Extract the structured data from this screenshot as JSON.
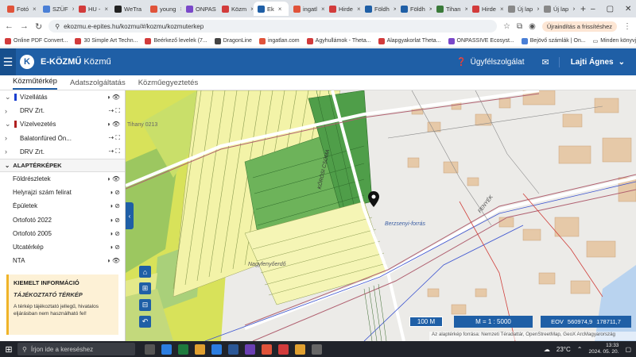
{
  "browser": {
    "tabs": [
      {
        "label": "Fotó",
        "color": "#e0533a"
      },
      {
        "label": "SZÜF",
        "color": "#4a7fd6"
      },
      {
        "label": "HU -",
        "color": "#d23b3b"
      },
      {
        "label": "WeTra",
        "color": "#222222"
      },
      {
        "label": "young",
        "color": "#e0533a"
      },
      {
        "label": "ONPAS",
        "color": "#7a48c9"
      },
      {
        "label": "Közm",
        "color": "#d23b3b"
      },
      {
        "label": "Ek",
        "color": "#1f5fa6",
        "active": true
      },
      {
        "label": "ingatl",
        "color": "#e0533a"
      },
      {
        "label": "Hirde",
        "color": "#d23b3b"
      },
      {
        "label": "Földh",
        "color": "#1f5fa6"
      },
      {
        "label": "Földh",
        "color": "#1f5fa6"
      },
      {
        "label": "Tihan",
        "color": "#3a7a3a"
      },
      {
        "label": "Hirde",
        "color": "#d23b3b"
      },
      {
        "label": "Új lap",
        "color": "#888888"
      },
      {
        "label": "Új lap",
        "color": "#888888"
      }
    ],
    "url": "ekozmu.e-epites.hu/kozmu/#/kozmu/kozmuterkep",
    "update_label": "Újraindítás a frissítéshez",
    "bookmarks": [
      {
        "label": "Online PDF Convert...",
        "color": "#d23b3b"
      },
      {
        "label": "30 Simple Art Techn...",
        "color": "#d23b3b"
      },
      {
        "label": "Beérkező levelek (7...",
        "color": "#d23b3b"
      },
      {
        "label": "DragonLine",
        "color": "#444444"
      },
      {
        "label": "ingatlan.com",
        "color": "#e0533a"
      },
      {
        "label": "Agyhullámok - Theta...",
        "color": "#d23b3b"
      },
      {
        "label": "Alapgyakorlat Theta...",
        "color": "#d23b3b"
      },
      {
        "label": "ONPASSIVE Ecosyst...",
        "color": "#7a48c9"
      },
      {
        "label": "Bejövő számlák | On...",
        "color": "#4a7fd6"
      }
    ],
    "bookmarks_right": "Minden könyvjelző"
  },
  "header": {
    "brand_bold": "E-KÖZMŰ",
    "brand_rest": "Közmű",
    "logo_letter": "K",
    "help_label": "Ügyfélszolgálat",
    "user_name": "Lajti Ágnes"
  },
  "subnav": [
    "Közműtérkép",
    "Adatszolgáltatás",
    "Közműegyeztetés"
  ],
  "sidebar": {
    "layers": [
      {
        "label": "Vízellátás",
        "chev": "⌄",
        "swatch": "#1a3fcf",
        "tools": "◑ 👁"
      },
      {
        "label": "DRV Zrt.",
        "chev": "›",
        "swatch": "",
        "tools": "⇢ ⛶"
      },
      {
        "label": "Vízelvezetés",
        "chev": "⌄",
        "swatch": "#b02020",
        "tools": "◑ 👁"
      },
      {
        "label": "Balatonfüred Ön...",
        "chev": "›",
        "swatch": "",
        "tools": "⇢ ⛶"
      },
      {
        "label": "DRV Zrt.",
        "chev": "›",
        "swatch": "",
        "tools": "⇢ ⛶"
      }
    ],
    "section_title": "ALAPTÉRKÉPEK",
    "basemaps": [
      {
        "label": "Földrészletek",
        "tools": "◑ 👁"
      },
      {
        "label": "Helyrajzi szám felirat",
        "tools": "◑ ⊘"
      },
      {
        "label": "Épületek",
        "tools": "◑ ⊘"
      },
      {
        "label": "Ortofotó 2022",
        "tools": "◑ ⊘"
      },
      {
        "label": "Ortofotó 2005",
        "tools": "◑ ⊘"
      },
      {
        "label": "Utcatérkép",
        "tools": "◑ ⊘"
      },
      {
        "label": "NTA",
        "tools": "◑ 👁"
      }
    ],
    "info": {
      "title": "KIEMELT INFORMÁCIÓ",
      "subtitle": "TÁJÉKOZTATÓ TÉRKÉP",
      "text": "A térkép tájékoztató jellegű, hivatalos eljárásban nem használható fel!"
    }
  },
  "map": {
    "labels": {
      "street1": "KŐRÖSI CSOMA",
      "street2": "FENYÉK",
      "spring": "Berzsenyi-forrás",
      "area": "Nagyfenyőerdő",
      "hrsz": "Tihany 0213"
    },
    "scale_bar": "100 M",
    "ratio": "M = 1 : 5000",
    "coords_label": "EOV",
    "coords_x": "560974,9",
    "coords_y": "178711,7",
    "attribution": "Az alaptérkép forrása: Nemzeti Téradattár, OpenStreetMap, GeoX ArcMagyarország",
    "tools": [
      "⌂",
      "⊞",
      "⊟",
      "↶"
    ]
  },
  "taskbar": {
    "search_placeholder": "Írjon ide a kereséshez",
    "temperature": "23°C",
    "time": "13:33",
    "date": "2024. 05. 20."
  }
}
